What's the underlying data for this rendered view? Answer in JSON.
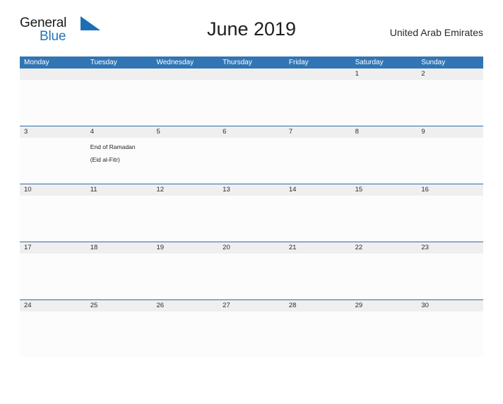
{
  "brand": {
    "word1": "General",
    "word2": "Blue",
    "flag_icon": "triangle-flag-icon",
    "color_dark": "#1a1a1a",
    "color_blue": "#2274b8"
  },
  "header": {
    "title": "June 2019",
    "locale": "United Arab Emirates"
  },
  "theme": {
    "header_blue": "#3175b4",
    "row_border": "#2d6ca8",
    "date_band": "#efeff0",
    "body_bg": "#fcfcfd"
  },
  "calendar": {
    "weekdays": [
      "Monday",
      "Tuesday",
      "Wednesday",
      "Thursday",
      "Friday",
      "Saturday",
      "Sunday"
    ],
    "weeks": [
      {
        "dates": [
          "",
          "",
          "",
          "",
          "",
          "1",
          "2"
        ],
        "events": [
          "",
          "",
          "",
          "",
          "",
          "",
          ""
        ]
      },
      {
        "dates": [
          "3",
          "4",
          "5",
          "6",
          "7",
          "8",
          "9"
        ],
        "events": [
          "",
          "End of Ramadan\n(Eid al-Fitr)",
          "",
          "",
          "",
          "",
          ""
        ]
      },
      {
        "dates": [
          "10",
          "11",
          "12",
          "13",
          "14",
          "15",
          "16"
        ],
        "events": [
          "",
          "",
          "",
          "",
          "",
          "",
          ""
        ]
      },
      {
        "dates": [
          "17",
          "18",
          "19",
          "20",
          "21",
          "22",
          "23"
        ],
        "events": [
          "",
          "",
          "",
          "",
          "",
          "",
          ""
        ]
      },
      {
        "dates": [
          "24",
          "25",
          "26",
          "27",
          "28",
          "29",
          "30"
        ],
        "events": [
          "",
          "",
          "",
          "",
          "",
          "",
          ""
        ]
      }
    ]
  }
}
